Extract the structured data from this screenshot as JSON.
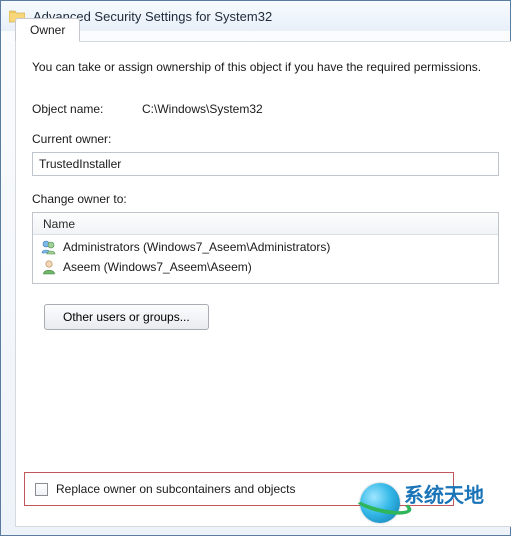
{
  "window": {
    "title": "Advanced Security Settings for System32"
  },
  "tab": {
    "label": "Owner"
  },
  "description": "You can take or assign ownership of this object if you have the required permissions.",
  "object": {
    "label": "Object name:",
    "value": "C:\\Windows\\System32"
  },
  "currentOwner": {
    "label": "Current owner:",
    "value": "TrustedInstaller"
  },
  "changeOwner": {
    "label": "Change owner to:",
    "header": "Name",
    "items": [
      {
        "text": "Administrators (Windows7_Aseem\\Administrators)",
        "icon": "group"
      },
      {
        "text": "Aseem (Windows7_Aseem\\Aseem)",
        "icon": "user"
      }
    ]
  },
  "buttons": {
    "otherUsers": "Other users or groups..."
  },
  "replace": {
    "label": "Replace owner on subcontainers and objects",
    "checked": false
  },
  "watermark": {
    "text": "系统天地"
  }
}
